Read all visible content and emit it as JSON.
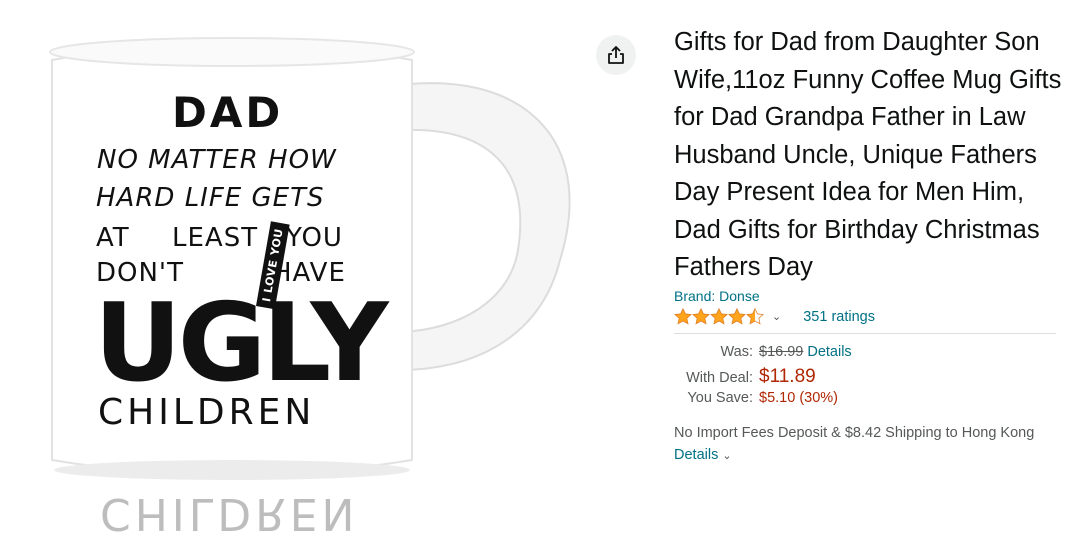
{
  "product": {
    "image_text": {
      "line_dad": "DAD",
      "line_1": "NO MATTER HOW",
      "line_2": "HARD LIFE GETS",
      "line_3a": "AT",
      "line_3b": "LEAST",
      "line_3c": "YOU",
      "line_4a": "DON'T",
      "line_4b": "HAVE",
      "line_ugly": "UGLY",
      "line_iloveyou": "I LOVE YOU",
      "line_children": "CHILDREN",
      "reflection": "CHILDREN"
    },
    "share_icon": "share-icon",
    "title": "Gifts for Dad from Daughter Son Wife,11oz Funny Coffee Mug Gifts for Dad Grandpa Father in Law Husband Uncle, Unique Fathers Day Present Idea for Men Him, Dad Gifts for Birthday Christmas Fathers Day",
    "brand": "Brand: Donse",
    "rating": 4.5,
    "ratings_count": "351 ratings",
    "price": {
      "was_label": "Was:",
      "was_value": "$16.99",
      "was_details": "Details",
      "deal_label": "With Deal:",
      "deal_value": "$11.89",
      "save_label": "You Save:",
      "save_value": "$5.10 (30%)"
    },
    "shipping_text": "No Import Fees Deposit & $8.42 Shipping to Hong Kong",
    "shipping_details": "Details"
  },
  "colors": {
    "link": "#007185",
    "price_red": "#B12704",
    "star": "#FFA41C"
  }
}
